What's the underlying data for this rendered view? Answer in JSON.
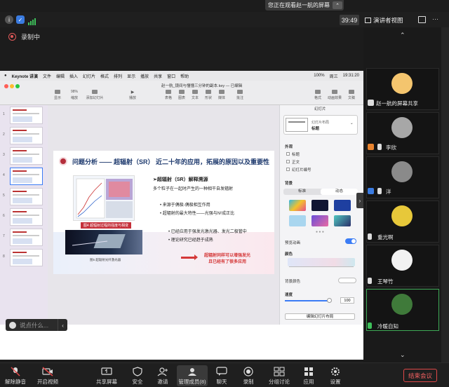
{
  "banner": {
    "text": "您正在观看赵一航的屏幕"
  },
  "topbar": {
    "time": "39:49",
    "view_mode": "演讲者视图"
  },
  "recording": {
    "label": "录制中"
  },
  "keynote": {
    "menu": [
      "Keynote 讲演",
      "文件",
      "编辑",
      "插入",
      "幻灯片",
      "格式",
      "排列",
      "显示",
      "播放",
      "共享",
      "窗口",
      "帮助"
    ],
    "status": {
      "zoom_percent": "100%",
      "day": "周三",
      "clock": "19:31:20"
    },
    "doc_title": "赵一航_镜间与懂懂三分钟的副本.key — 已编辑",
    "toolbar": [
      {
        "label": "显示"
      },
      {
        "label": "缩放",
        "value": "98%"
      },
      {
        "label": "添加幻灯片"
      },
      {
        "label": "播放"
      },
      {
        "label": "表格"
      },
      {
        "label": "图表"
      },
      {
        "label": "文本"
      },
      {
        "label": "形状"
      },
      {
        "label": "媒体"
      },
      {
        "label": "批注"
      },
      {
        "label": "格式"
      },
      {
        "label": "动画效果"
      },
      {
        "label": "文稿"
      }
    ],
    "slide_numbers": [
      "1",
      "2",
      "3",
      "4",
      "5",
      "6",
      "7",
      "8"
    ],
    "selected_slide": 4,
    "slide": {
      "title": "问题分析 —— 超辐射（SR） 近二十年的应用，拓展的原因以及重要性",
      "subheading": "➢超辐射（SR）解释溯源",
      "lines": [
        "多个粒子在一起时产生的一种相干自发辐射",
        "• 来源于偶极-偶极相互作用",
        "• 超辐射的最大特性——光强与N²成正比",
        "• 已经应用于强发光激光器、发光二极管中",
        "• 理论研究已经趋于成熟"
      ],
      "image_tag": "图4 超辐射过程的强度与相变",
      "image_caption": "图5 超辐射光纤激光器",
      "conclusion": [
        "超辐射同样可以增强发光",
        "且已经有了很多应用"
      ]
    },
    "inspector": {
      "header": "幻灯片",
      "layout_title": "幻灯片布局",
      "layout_name": "标题",
      "appearance_label": "外观",
      "checkboxes": [
        "标题",
        "正文",
        "幻灯片编号"
      ],
      "background_label": "背景",
      "tabs": [
        "标准",
        "动态"
      ],
      "active_tab": "动态",
      "preview_label": "预览动画",
      "color_label": "颜色",
      "bg_color_label": "背景颜色",
      "speed_label": "速度",
      "speed_value": "100",
      "edit_button": "编辑幻灯片布局",
      "swatch_colors": [
        "#2fb7e8",
        "#111533",
        "#1e3fa0",
        "#a9d6ef",
        "#6a4fd9",
        "#50c7c0"
      ]
    }
  },
  "chat": {
    "placeholder": "说点什么..."
  },
  "participants": [
    {
      "name": "赵一航的屏幕共享",
      "avatar_color": "#f4c56e"
    },
    {
      "name": "李欣",
      "avatar_color": "#a7a7a7"
    },
    {
      "name": "洋",
      "avatar_color": "#8a8a8a"
    },
    {
      "name": "重光啊",
      "avatar_color": "#e7c83a"
    },
    {
      "name": "王琴竹",
      "avatar_color": "#f2f2f2"
    },
    {
      "name": "冷暖自知",
      "avatar_color": "#3f7a3a"
    }
  ],
  "bottombar": {
    "items": [
      {
        "label": "解除静音",
        "icon": "mic-muted-icon"
      },
      {
        "label": "开启视频",
        "icon": "video-off-icon"
      },
      {
        "label": "共享屏幕",
        "icon": "share-screen-icon"
      },
      {
        "label": "安全",
        "icon": "shield-icon"
      },
      {
        "label": "邀请",
        "icon": "invite-icon"
      },
      {
        "label": "管理成员(8)",
        "icon": "members-icon"
      },
      {
        "label": "聊天",
        "icon": "chat-icon"
      },
      {
        "label": "录制",
        "icon": "record-icon"
      },
      {
        "label": "分组讨论",
        "icon": "breakout-icon"
      },
      {
        "label": "应用",
        "icon": "apps-icon"
      },
      {
        "label": "设置",
        "icon": "settings-icon"
      }
    ],
    "end_label": "结束会议",
    "accent": "#e04848"
  }
}
